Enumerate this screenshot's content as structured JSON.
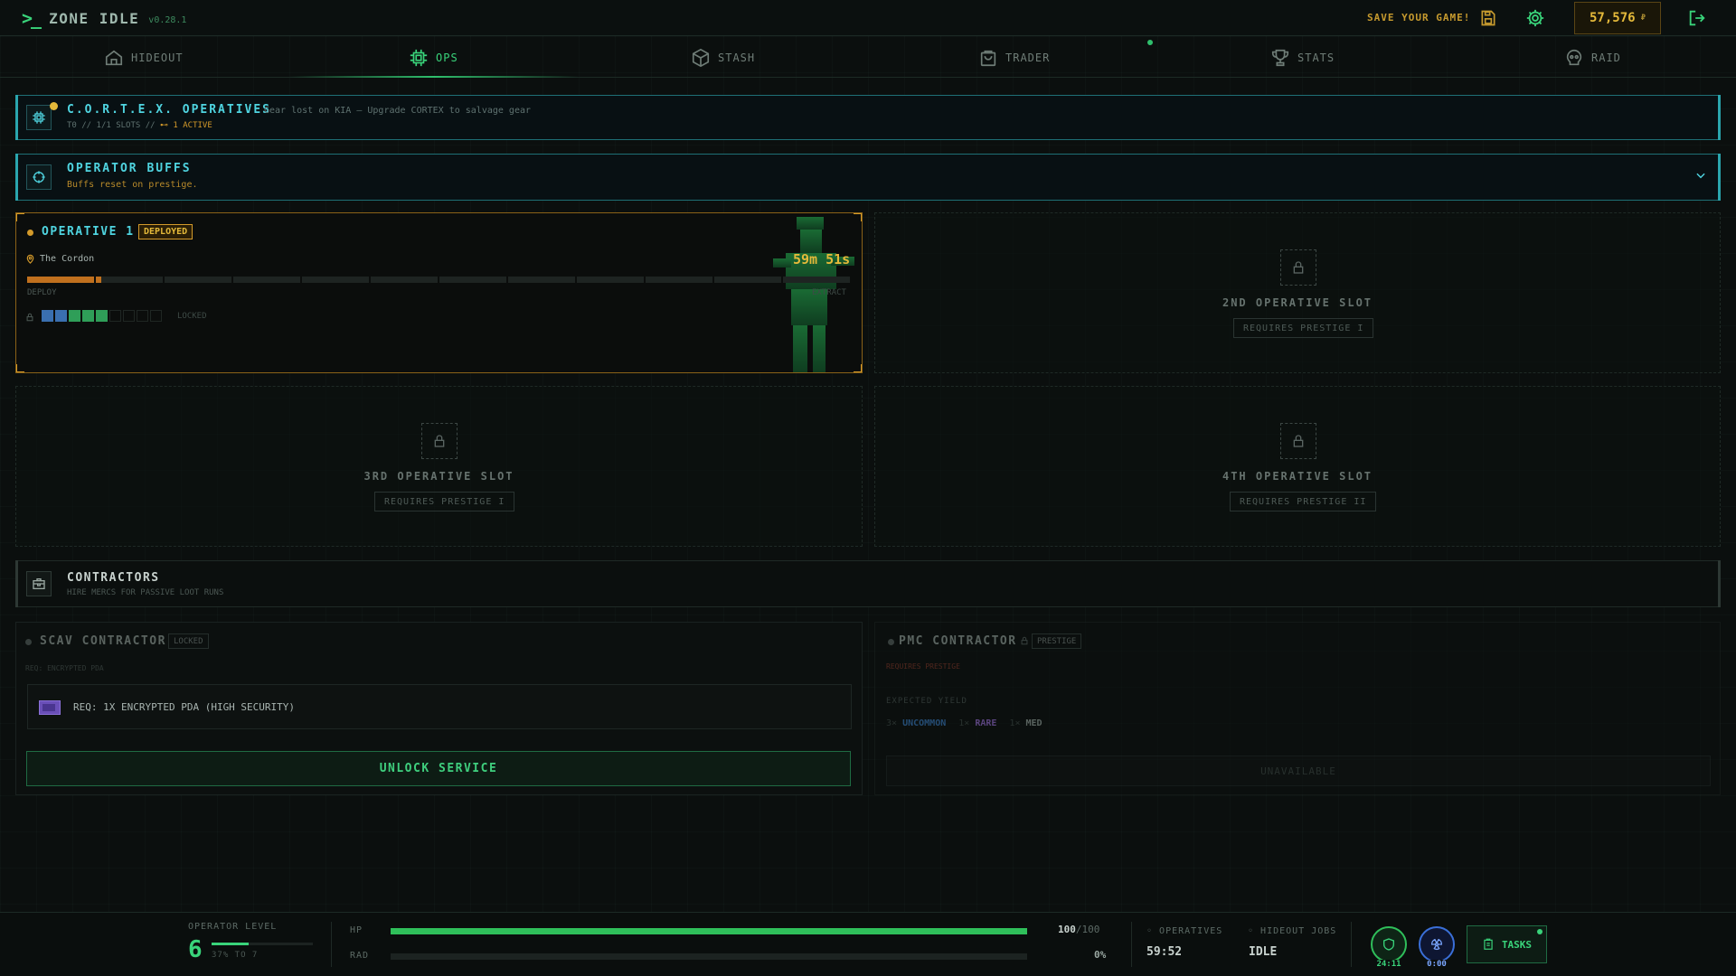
{
  "app": {
    "prompt": ">_",
    "title": "ZONE IDLE",
    "version": "v0.28.1"
  },
  "topbar": {
    "save_text": "SAVE YOUR GAME!",
    "money": "57,576",
    "money_unit": "₽"
  },
  "nav": {
    "tabs": [
      {
        "label": "HIDEOUT",
        "icon": "home-icon"
      },
      {
        "label": "OPS",
        "icon": "chip-icon",
        "active": true
      },
      {
        "label": "STASH",
        "icon": "box-icon"
      },
      {
        "label": "TRADER",
        "icon": "bag-icon"
      },
      {
        "label": "STATS",
        "icon": "trophy-icon"
      },
      {
        "label": "RAID",
        "icon": "skull-icon"
      }
    ]
  },
  "cortex": {
    "title": "C.O.R.T.E.X. OPERATIVES",
    "note": "Gear lost on KIA — Upgrade CORTEX to salvage gear",
    "tier": "T0",
    "slots": "1/1 SLOTS",
    "active": "1 ACTIVE"
  },
  "buffs": {
    "title": "OPERATOR BUFFS",
    "subtitle": "Buffs reset on prestige."
  },
  "operative1": {
    "name": "OPERATIVE 1",
    "status": "DEPLOYED",
    "location": "The Cordon",
    "timer": "59m 51s",
    "progress": 0.09,
    "phase_start": "DEPLOY",
    "phase_end": "EXTRACT",
    "loadout_label": "LOCKED"
  },
  "slots": [
    {
      "name": "2ND OPERATIVE SLOT",
      "req": "REQUIRES PRESTIGE I"
    },
    {
      "name": "3RD OPERATIVE SLOT",
      "req": "REQUIRES PRESTIGE I"
    },
    {
      "name": "4TH OPERATIVE SLOT",
      "req": "REQUIRES PRESTIGE II"
    }
  ],
  "contractors": {
    "title": "CONTRACTORS",
    "subtitle": "HIRE MERCS FOR PASSIVE LOOT RUNS",
    "scav": {
      "title": "SCAV CONTRACTOR",
      "badge": "LOCKED",
      "req_short": "REQ: ENCRYPTED PDA",
      "req_item": "REQ: 1X ENCRYPTED PDA (HIGH SECURITY)",
      "button": "UNLOCK SERVICE"
    },
    "pmc": {
      "title": "PMC CONTRACTOR",
      "badge": "PRESTIGE",
      "requires": "REQUIRES PRESTIGE",
      "yield_label": "EXPECTED YIELD",
      "yield": [
        {
          "qty": "3×",
          "label": "UNCOMMON"
        },
        {
          "qty": "1×",
          "label": "RARE"
        },
        {
          "qty": "1×",
          "label": "MED"
        }
      ],
      "button": "UNAVAILABLE"
    }
  },
  "bottom": {
    "level_label": "OPERATOR LEVEL",
    "level": "6",
    "level_progress_text": "37% TO 7",
    "level_progress": 0.37,
    "hp_label": "HP",
    "hp_value": "100",
    "hp_max": "/100",
    "hp_fraction": 1.0,
    "rad_label": "RAD",
    "rad_value": "0%",
    "rad_fraction": 0.0,
    "operatives_label": "OPERATIVES",
    "operatives_value": "59:52",
    "jobs_label": "HIDEOUT JOBS",
    "jobs_value": "IDLE",
    "shield_time": "24:11",
    "rad_time": "0:00",
    "tasks_label": "TASKS"
  },
  "colors": {
    "accent": "#39d37a",
    "cyan": "#4fd4e0",
    "gold": "#e4b93a",
    "warning": "#d49a2a"
  }
}
